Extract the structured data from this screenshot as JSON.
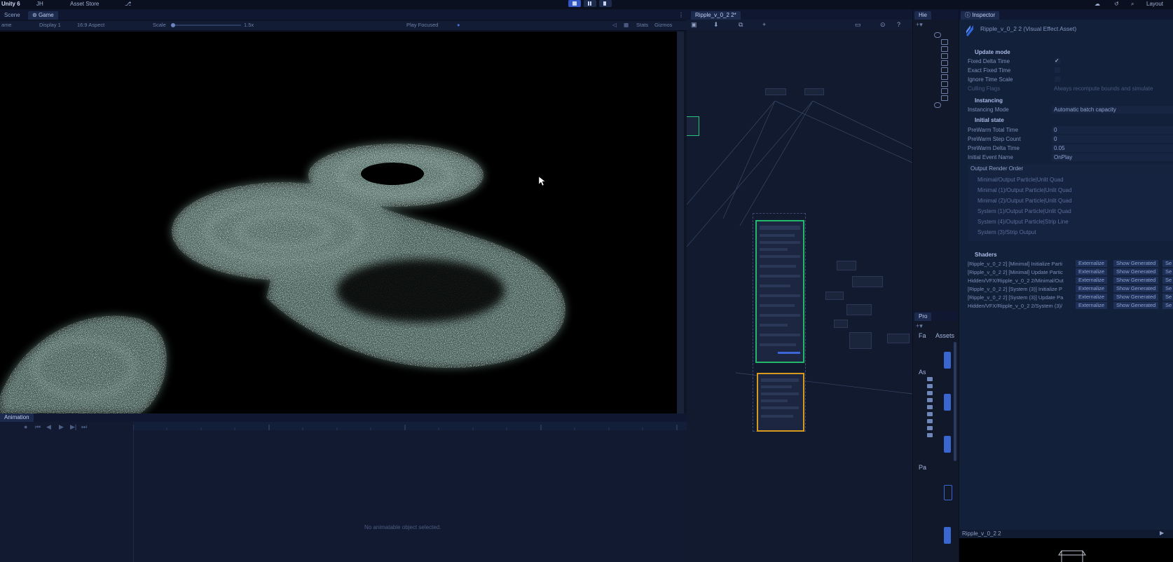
{
  "topbar": {
    "app": "Unity 6",
    "account": "JH",
    "asset_store": "Asset Store",
    "layout": "Layout"
  },
  "game_view": {
    "tabs": [
      "Scene",
      "Game"
    ],
    "mode": "ame",
    "display": "Display 1",
    "aspect": "16:9 Aspect",
    "scale_label": "Scale",
    "scale_value": "1.5x",
    "play_focused": "Play Focused",
    "stats": "Stats",
    "gizmos": "Gizmos"
  },
  "animation": {
    "tab": "Animation",
    "empty_message": "No animatable object selected."
  },
  "vfx_graph": {
    "tab": "Ripple_v_0_2 2*"
  },
  "hierarchy": {
    "tab": "Hie"
  },
  "project": {
    "tab": "Pro",
    "assets_label": "Assets",
    "fav_label": "Fa",
    "assets_folder": "As",
    "packages_folder": "Pa"
  },
  "inspector": {
    "tab": "Inspector",
    "asset_title": "Ripple_v_0_2 2 (Visual Effect Asset)",
    "update_mode": {
      "header": "Update mode",
      "fixed_delta_time": "Fixed Delta Time",
      "exact_fixed_time": "Exact Fixed Time",
      "ignore_time_scale": "Ignore Time Scale",
      "culling_flags": "Culling Flags",
      "culling_value": "Always recompute bounds and simulate"
    },
    "instancing": {
      "header": "Instancing",
      "mode_label": "Instancing Mode",
      "mode_value": "Automatic batch capacity"
    },
    "initial_state": {
      "header": "Initial state",
      "rows": [
        {
          "label": "PreWarm Total Time",
          "value": "0"
        },
        {
          "label": "PreWarm Step Count",
          "value": "0"
        },
        {
          "label": "PreWarm Delta Time",
          "value": "0.05"
        },
        {
          "label": "Initial Event Name",
          "value": "OnPlay"
        }
      ]
    },
    "output_order": {
      "header": "Output Render Order",
      "items": [
        "Minimal/Output Particle|Unlit Quad",
        "Minimal (1)/Output Particle|Unlit Quad",
        "Minimal (2)/Output Particle|Unlit Quad",
        "System (1)/Output Particle|Unlit Quad",
        "System (4)/Output Particle|Strip Line",
        "System (3)/Strip Output"
      ]
    },
    "shaders": {
      "header": "Shaders",
      "rows": [
        "[Ripple_v_0_2 2] [Minimal] Initialize Parti",
        "[Ripple_v_0_2 2] [Minimal] Update Partic",
        "Hidden/VFX/Ripple_v_0_2 2/Minimal/Out",
        "[Ripple_v_0_2 2] [System (3)] Initialize P",
        "[Ripple_v_0_2 2] [System (3)] Update Pa",
        "Hidden/VFX/Ripple_v_0_2 2/System (3)/"
      ],
      "externalize": "Externalize",
      "show_generated": "Show Generated",
      "se": "Se"
    },
    "footer_name": "Ripple_v_0_2 2"
  }
}
